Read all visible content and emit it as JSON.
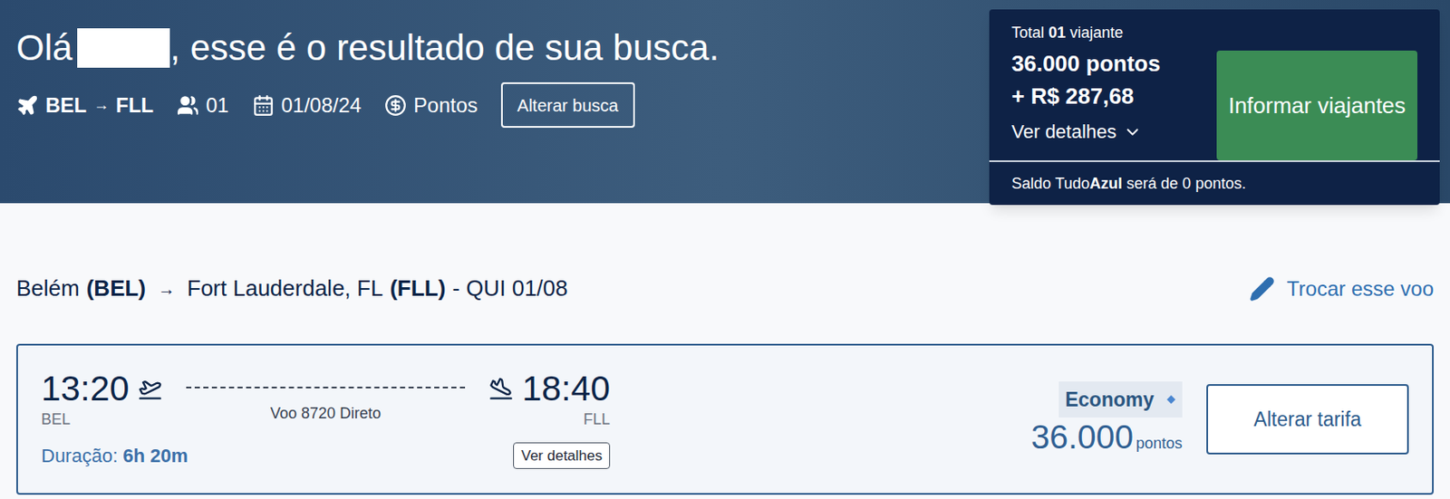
{
  "header": {
    "greeting_prefix": "Olá",
    "greeting_suffix": ", esse é o resultado de sua busca."
  },
  "search": {
    "origin": "BEL",
    "arrow": "→",
    "destination": "FLL",
    "passengers": "01",
    "date": "01/08/24",
    "currency": "Pontos",
    "change_button": "Alterar busca"
  },
  "summary": {
    "total_prefix": "Total",
    "travelers": "01",
    "total_suffix": "viajante",
    "points": "36.000 pontos",
    "cash": "+ R$ 287,68",
    "details_link": "Ver detalhes",
    "button": "Informar viajantes",
    "balance_prefix": "Saldo Tudo",
    "balance_brand": "Azul",
    "balance_suffix": "será de 0 pontos."
  },
  "route": {
    "origin_city": "Belém",
    "origin_code": "(BEL)",
    "arrow": "→",
    "destination_city": "Fort Lauderdale, FL",
    "destination_code": "(FLL)",
    "date": "- QUI 01/08",
    "change_link": "Trocar esse voo"
  },
  "flight": {
    "departure_time": "13:20",
    "departure_airport": "BEL",
    "flight_label": "Voo 8720 Direto",
    "arrival_time": "18:40",
    "arrival_airport": "FLL",
    "duration_label": "Duração:",
    "duration": "6h 20m",
    "details_button": "Ver detalhes",
    "fare_class": "Economy",
    "price": "36.000",
    "price_unit": "pontos",
    "change_fare_button": "Alterar tarifa"
  }
}
